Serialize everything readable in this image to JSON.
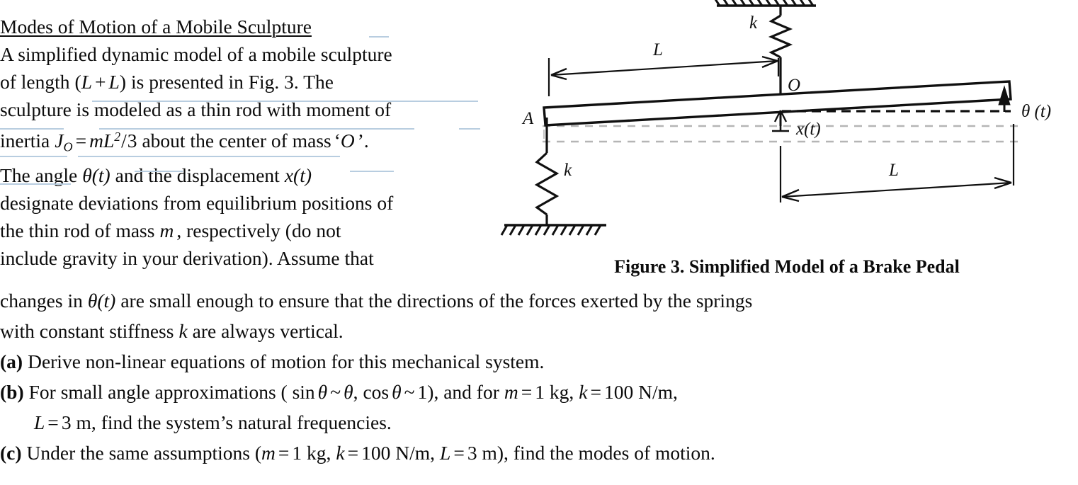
{
  "document": {
    "title": "Modes of Motion of a Mobile Sculpture",
    "paragraph_lines": [
      "A simplified dynamic model of a mobile sculpture",
      "of length (L + L) is presented in Fig. 3.  The",
      "sculpture is modeled as a thin rod with moment of",
      "inertia J_O = mL²/3 about the center of mass ‘O’.",
      "The angle θ(t) and the displacement x(t)",
      "designate deviations from equilibrium positions of",
      "the thin rod of mass m , respectively (do not",
      "include gravity in your derivation).  Assume that"
    ],
    "continuation_lines": [
      "changes in θ(t) are small enough to ensure that the directions of the forces exerted by the springs",
      "with constant stiffness k  are always vertical."
    ],
    "items": [
      {
        "marker": "(a)",
        "lines": [
          "Derive non-linear equations of motion for this mechanical system."
        ]
      },
      {
        "marker": "(b)",
        "lines": [
          "For small angle approximations ( sin θ ~ θ,  cos θ ~ 1 ), and for m = 1 kg, k = 100  N/m,",
          "L = 3  m, find the system’s natural frequencies."
        ]
      },
      {
        "marker": "(c)",
        "lines": [
          "Under the same assumptions ( m = 1 kg, k = 100  N/m, L = 3  m), find the modes of motion."
        ]
      }
    ],
    "text_fragments": {
      "t1_a": "A simplified dynamic model of a mobile sculpture",
      "t2_a": "of length",
      "t2_paren_open": "(",
      "t2_L1": "L",
      "t2_plus": "+",
      "t2_L2": "L",
      "t2_paren_close": ")",
      "t2_b": "is presented in Fig. 3.  The",
      "t3_a": "sculpture is modeled as a thin rod with moment of",
      "t4_a": "inertia",
      "t4_J": "J",
      "t4_Jsub": "O",
      "t4_eq": "=",
      "t4_m": "m",
      "t4_L": "L",
      "t4_exp": "2",
      "t4_slash": "/",
      "t4_three": "3",
      "t4_b": "about the center of mass",
      "t4_quote_open": "‘",
      "t4_O": "O",
      "t4_quote_close": "’.",
      "t5_a": "The angle",
      "t5_theta": "θ",
      "t5_tparen": "(t)",
      "t5_b": "and the displacement",
      "t5_x": "x",
      "t5_xparen": "(t)",
      "t6_a": "designate deviations from equilibrium positions of",
      "t7_a": "the thin rod of mass",
      "t7_m": "m",
      "t7_b": ", respectively (do not",
      "t8_a": "include gravity in your derivation).  Assume that",
      "t9_a": "changes in",
      "t9_theta": "θ",
      "t9_tparen": "(t)",
      "t9_b": "are small enough to ensure that the directions of the forces exerted by the springs",
      "t10_a": "with constant stiffness",
      "t10_k": "k",
      "t10_b": "are always vertical.",
      "ta_marker": "(a)",
      "ta_text": "Derive non-linear equations of motion for this mechanical system.",
      "tb_marker": "(b)",
      "tb_a": "For small angle approximations ( sin",
      "tb_theta1": "θ",
      "tb_tilde1": "~",
      "tb_theta2": "θ",
      "tb_comma": ",",
      "tb_cos": "cos",
      "tb_theta3": "θ",
      "tb_tilde2": "~",
      "tb_one": "1",
      "tb_b": "), and for",
      "tb_m": "m",
      "tb_eq1": "=",
      "tb_mval": "1 kg,",
      "tb_k": "k",
      "tb_eq2": "=",
      "tb_kval": "100  N/m,",
      "tb2_L": "L",
      "tb2_eq": "=",
      "tb2_val": "3  m,",
      "tb2_text": "find the system’s natural frequencies.",
      "tc_marker": "(c)",
      "tc_a": "Under the same assumptions (",
      "tc_m": "m",
      "tc_eq1": "=",
      "tc_mval": "1 kg,",
      "tc_k": "k",
      "tc_eq2": "=",
      "tc_kval": "100  N/m,",
      "tc_L": "L",
      "tc_eq3": "=",
      "tc_Lval": "3  m),",
      "tc_b": "find the modes of motion."
    }
  },
  "figure": {
    "caption": "Figure 3.  Simplified Model of a Brake Pedal",
    "labels": {
      "spring_top_k": "k",
      "spring_bottom_k": "k",
      "pivot_O": "O",
      "point_A": "A",
      "dim_top_L": "L",
      "dim_bottom_L": "L",
      "theta": "θ (t)",
      "x_disp": "x(t)"
    },
    "colors": {
      "line": "#101010",
      "dashed_gray": "#b5b5b5",
      "background": "#ffffff"
    }
  }
}
